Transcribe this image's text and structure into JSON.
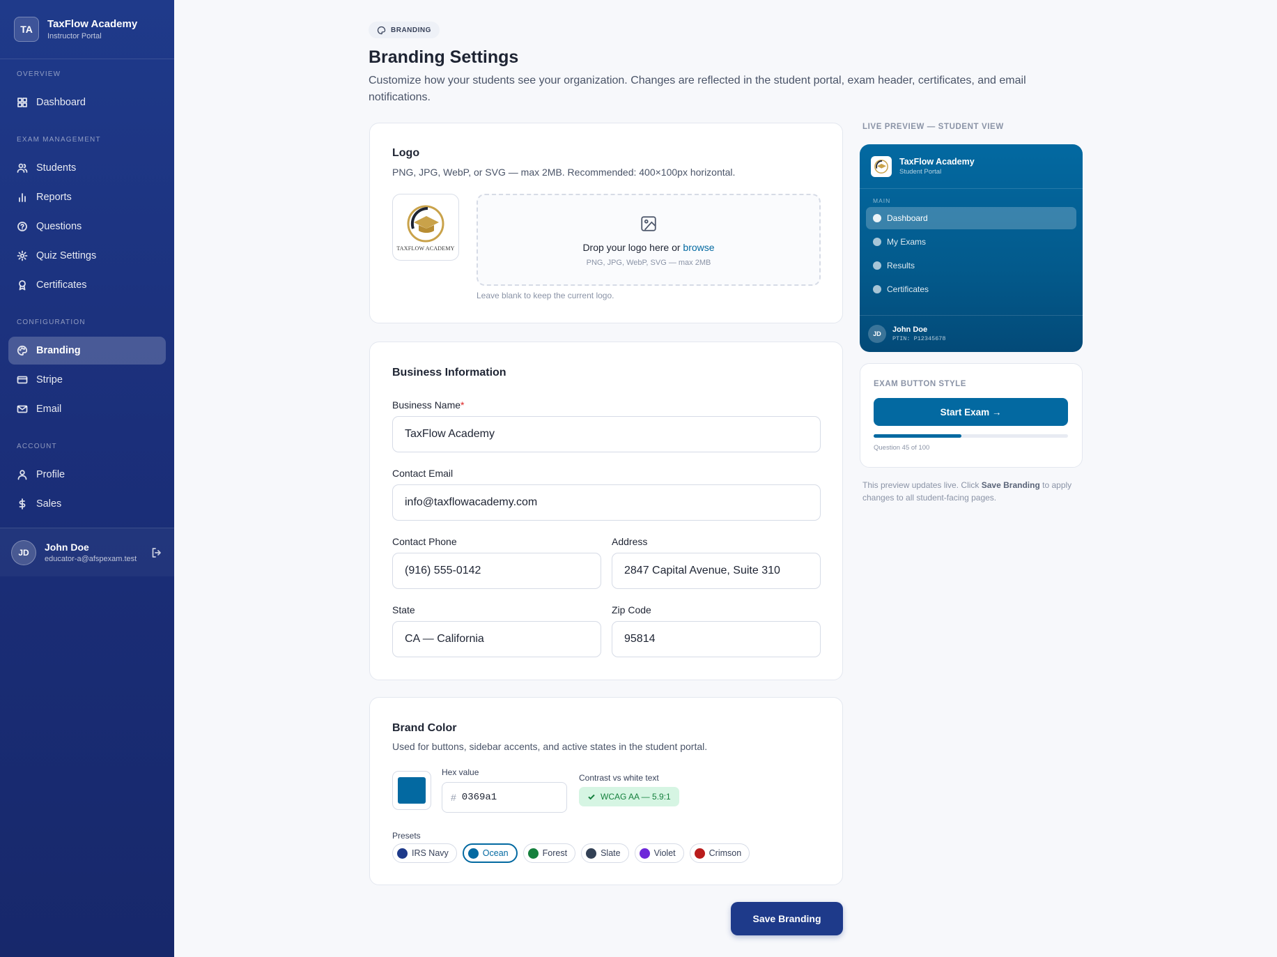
{
  "brand": {
    "initials": "TA",
    "name": "TaxFlow Academy",
    "subtitle": "Instructor Portal"
  },
  "nav": {
    "sections": [
      {
        "title": "OVERVIEW",
        "items": [
          {
            "label": "Dashboard",
            "icon": "grid-icon"
          }
        ]
      },
      {
        "title": "EXAM MANAGEMENT",
        "items": [
          {
            "label": "Students",
            "icon": "users-icon"
          },
          {
            "label": "Reports",
            "icon": "bar-chart-icon"
          },
          {
            "label": "Questions",
            "icon": "help-circle-icon"
          },
          {
            "label": "Quiz Settings",
            "icon": "gear-icon"
          },
          {
            "label": "Certificates",
            "icon": "award-icon"
          }
        ]
      },
      {
        "title": "CONFIGURATION",
        "items": [
          {
            "label": "Branding",
            "icon": "palette-icon",
            "active": true
          },
          {
            "label": "Stripe",
            "icon": "credit-card-icon"
          },
          {
            "label": "Email",
            "icon": "mail-icon"
          }
        ]
      },
      {
        "title": "ACCOUNT",
        "items": [
          {
            "label": "Profile",
            "icon": "user-icon"
          },
          {
            "label": "Sales",
            "icon": "dollar-icon"
          }
        ]
      }
    ]
  },
  "user": {
    "initials": "JD",
    "name": "John Doe",
    "email": "educator-a@afspexam.test"
  },
  "header": {
    "crumb": "BRANDING",
    "title": "Branding Settings",
    "description": "Customize how your students see your organization. Changes are reflected in the student portal, exam header, certificates, and email notifications."
  },
  "logo_card": {
    "title": "Logo",
    "subtitle": "PNG, JPG, WebP, or SVG — max 2MB. Recommended: 400×100px horizontal.",
    "thumb_text": "TAXFLOW ACADEMY",
    "drop_text": "Drop your logo here or",
    "drop_link": "browse",
    "drop_formats": "PNG, JPG, WebP, SVG — max 2MB",
    "hint": "Leave blank to keep the current logo."
  },
  "business_card": {
    "title": "Business Information",
    "business_name_label": "Business Name",
    "required_mark": "*",
    "business_name": "TaxFlow Academy",
    "email_label": "Contact Email",
    "email": "info@taxflowacademy.com",
    "phone_label": "Contact Phone",
    "phone": "(916) 555-0142",
    "address_label": "Address",
    "address": "2847 Capital Avenue, Suite 310",
    "state_label": "State",
    "state": "CA — California",
    "zip_label": "Zip Code",
    "zip": "95814"
  },
  "color_card": {
    "title": "Brand Color",
    "subtitle": "Used for buttons, sidebar accents, and active states in the student portal.",
    "hex_label": "Hex value",
    "hex_prefix": "#",
    "hex_value": "0369a1",
    "swatch_color": "#0369a1",
    "contrast_label": "Contrast vs white text",
    "contrast_value": "WCAG AA — 5.9:1",
    "presets_label": "Presets",
    "presets": [
      {
        "label": "IRS Navy",
        "color": "#1e3a8a"
      },
      {
        "label": "Ocean",
        "color": "#0369a1",
        "selected": true
      },
      {
        "label": "Forest",
        "color": "#15803d"
      },
      {
        "label": "Slate",
        "color": "#334155"
      },
      {
        "label": "Violet",
        "color": "#6d28d9"
      },
      {
        "label": "Crimson",
        "color": "#b91c1c"
      }
    ]
  },
  "save_label": "Save Branding",
  "preview": {
    "label": "LIVE PREVIEW — STUDENT VIEW",
    "name": "TaxFlow Academy",
    "subtitle": "Student Portal",
    "section": "MAIN",
    "items": [
      {
        "label": "Dashboard",
        "active": true
      },
      {
        "label": "My Exams"
      },
      {
        "label": "Results"
      },
      {
        "label": "Certificates"
      }
    ],
    "user_initials": "JD",
    "user_name": "John Doe",
    "user_ptin": "PTIN: P12345678",
    "exam_label": "EXAM BUTTON STYLE",
    "exam_button": "Start Exam →",
    "progress_fraction": 0.45,
    "progress_text": "Question 45 of 100",
    "note_pre": "This preview updates live. Click",
    "note_bold": "Save Branding",
    "note_post": "to apply changes to all student-facing pages."
  }
}
